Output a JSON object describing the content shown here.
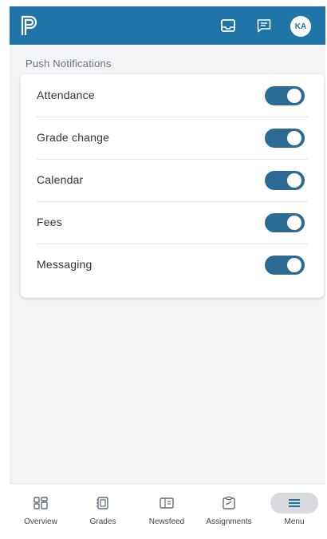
{
  "header": {
    "avatar_initials": "KA",
    "colors": {
      "background": "#1f74a8",
      "icon": "#ffffff"
    },
    "icons": [
      "logo-icon",
      "inbox-icon",
      "message-icon"
    ]
  },
  "section": {
    "title": "Push Notifications"
  },
  "notifications": [
    {
      "label": "Attendance",
      "enabled": true
    },
    {
      "label": "Grade change",
      "enabled": true
    },
    {
      "label": "Calendar",
      "enabled": true
    },
    {
      "label": "Fees",
      "enabled": true
    },
    {
      "label": "Messaging",
      "enabled": true
    }
  ],
  "toggle_color": "#2b6a93",
  "bottom_nav": {
    "items": [
      {
        "label": "Overview",
        "icon": "overview-icon",
        "active": false
      },
      {
        "label": "Grades",
        "icon": "grades-icon",
        "active": false
      },
      {
        "label": "Newsfeed",
        "icon": "newsfeed-icon",
        "active": false
      },
      {
        "label": "Assignments",
        "icon": "assignments-icon",
        "active": false
      },
      {
        "label": "Menu",
        "icon": "menu-icon",
        "active": true
      }
    ],
    "active_color": "#1f74a8"
  }
}
